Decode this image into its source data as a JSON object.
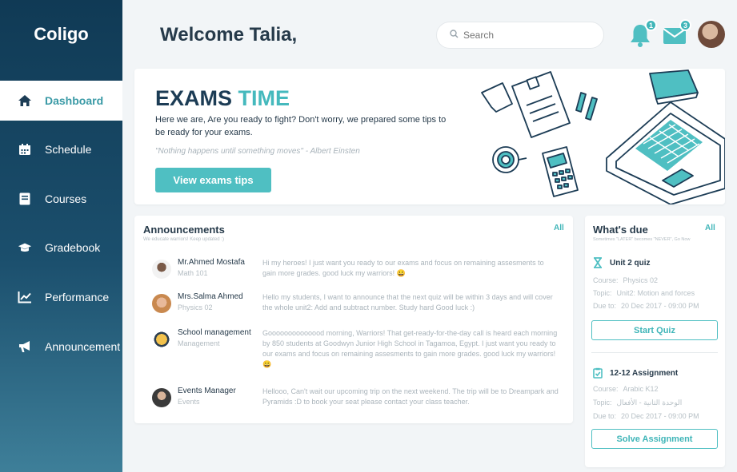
{
  "sidebar": {
    "logo": "Coligo",
    "items": [
      {
        "label": "Dashboard",
        "icon": "home-icon",
        "active": true
      },
      {
        "label": "Schedule",
        "icon": "calendar-icon",
        "active": false
      },
      {
        "label": "Courses",
        "icon": "book-icon",
        "active": false
      },
      {
        "label": "Gradebook",
        "icon": "graduation-cap-icon",
        "active": false
      },
      {
        "label": "Performance",
        "icon": "chart-icon",
        "active": false
      },
      {
        "label": "Announcement",
        "icon": "megaphone-icon",
        "active": false
      }
    ]
  },
  "header": {
    "title": "Welcome Talia,",
    "search_placeholder": "Search",
    "notifications_count": "1",
    "messages_count": "3"
  },
  "hero": {
    "title_part1": "EXAMS",
    "title_part2": "TIME",
    "text": "Here we are, Are you ready to fight? Don't worry, we prepared some tips to be ready for your exams.",
    "quote": "\"Nothing happens until something moves\" - Albert Einsten",
    "button": "View exams tips"
  },
  "announcements": {
    "title": "Announcements",
    "subtitle": "We educate warriors! Keep updated :)",
    "all": "All",
    "items": [
      {
        "name": "Mr.Ahmed Mostafa",
        "sub": "Math 101",
        "message": "Hi my heroes! I just want you ready to our exams and focus on remaining assesments to gain more grades. good luck my warriors! 😀"
      },
      {
        "name": "Mrs.Salma Ahmed",
        "sub": "Physics 02",
        "message": "Hello my students, I want to announce that the next quiz will be within 3 days and will cover the whole unit2: Add and subtract number. Study hard Good luck :)"
      },
      {
        "name": "School management",
        "sub": "Management",
        "message": "Goooooooooooood morning, Warriors! That get-ready-for-the-day call is heard each morning by 850 students at Goodwyn Junior High School in Tagamoa, Egypt. I just want you ready to our exams and focus on remaining assesments to gain more grades. good luck my warriors! 😀"
      },
      {
        "name": "Events Manager",
        "sub": "Events",
        "message": "Hellooo, Can't wait our upcoming trip on the next weekend. The trip will be to Dreampark and Pyramids :D to book your seat please contact your class teacher."
      }
    ]
  },
  "due": {
    "title": "What's due",
    "subtitle": "Sometimes \"LATER\" becomes \"NEVER\", Go Now",
    "all": "All",
    "items": [
      {
        "title": "Unit 2 quiz",
        "icon": "hourglass-icon",
        "course_label": "Course:",
        "course": "Physics 02",
        "topic_label": "Topic:",
        "topic": "Unit2: Motion and forces",
        "due_label": "Due to:",
        "due": "20 Dec 2017 - 09:00 PM",
        "button": "Start Quiz"
      },
      {
        "title": "12-12 Assignment",
        "icon": "clipboard-check-icon",
        "course_label": "Course:",
        "course": "Arabic K12",
        "topic_label": "Topic:",
        "topic": "الوحدة الثانية - الأفعال",
        "due_label": "Due to:",
        "due": "20 Dec 2017 - 09:00 PM",
        "button": "Solve Assignment"
      }
    ]
  },
  "colors": {
    "sidebar_top": "#103a55",
    "sidebar_bottom": "#3e7f99",
    "accent": "#4fbfc2",
    "title_dark": "#1c3c55"
  }
}
